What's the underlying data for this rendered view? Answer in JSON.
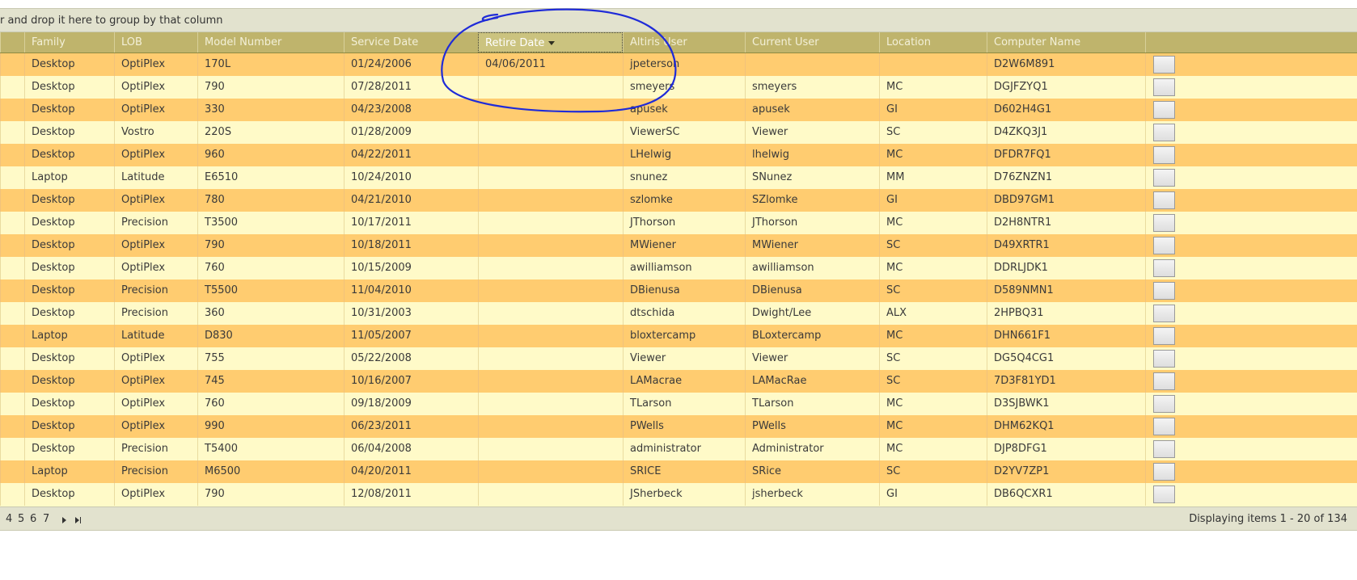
{
  "group_panel": {
    "hint": "r and drop it here to group by that column"
  },
  "columns": [
    {
      "label": "Family"
    },
    {
      "label": "LOB"
    },
    {
      "label": "Model Number"
    },
    {
      "label": "Service Date"
    },
    {
      "label": "Retire Date"
    },
    {
      "label": "Altiris User"
    },
    {
      "label": "Current User"
    },
    {
      "label": "Location"
    },
    {
      "label": "Computer Name"
    }
  ],
  "sorted_column": "Retire Date",
  "rows": [
    [
      "Desktop",
      "OptiPlex",
      "170L",
      "01/24/2006",
      "04/06/2011",
      "jpeterson",
      "",
      "",
      "D2W6M891"
    ],
    [
      "Desktop",
      "OptiPlex",
      "790",
      "07/28/2011",
      "",
      "smeyers",
      "smeyers",
      "MC",
      "DGJFZYQ1"
    ],
    [
      "Desktop",
      "OptiPlex",
      "330",
      "04/23/2008",
      "",
      "apusek",
      "apusek",
      "GI",
      "D602H4G1"
    ],
    [
      "Desktop",
      "Vostro",
      "220S",
      "01/28/2009",
      "",
      "ViewerSC",
      "Viewer",
      "SC",
      "D4ZKQ3J1"
    ],
    [
      "Desktop",
      "OptiPlex",
      "960",
      "04/22/2011",
      "",
      "LHelwig",
      "lhelwig",
      "MC",
      "DFDR7FQ1"
    ],
    [
      "Laptop",
      "Latitude",
      "E6510",
      "10/24/2010",
      "",
      "snunez",
      "SNunez",
      "MM",
      "D76ZNZN1"
    ],
    [
      "Desktop",
      "OptiPlex",
      "780",
      "04/21/2010",
      "",
      "szlomke",
      "SZlomke",
      "GI",
      "DBD97GM1"
    ],
    [
      "Desktop",
      "Precision",
      "T3500",
      "10/17/2011",
      "",
      "JThorson",
      "JThorson",
      "MC",
      "D2H8NTR1"
    ],
    [
      "Desktop",
      "OptiPlex",
      "790",
      "10/18/2011",
      "",
      "MWiener",
      "MWiener",
      "SC",
      "D49XRTR1"
    ],
    [
      "Desktop",
      "OptiPlex",
      "760",
      "10/15/2009",
      "",
      "awilliamson",
      "awilliamson",
      "MC",
      "DDRLJDK1"
    ],
    [
      "Desktop",
      "Precision",
      "T5500",
      "11/04/2010",
      "",
      "DBienusa",
      "DBienusa",
      "SC",
      "D589NMN1"
    ],
    [
      "Desktop",
      "Precision",
      "360",
      "10/31/2003",
      "",
      "dtschida",
      "Dwight/Lee",
      "ALX",
      "2HPBQ31"
    ],
    [
      "Laptop",
      "Latitude",
      "D830",
      "11/05/2007",
      "",
      "bloxtercamp",
      "BLoxtercamp",
      "MC",
      "DHN661F1"
    ],
    [
      "Desktop",
      "OptiPlex",
      "755",
      "05/22/2008",
      "",
      "Viewer",
      "Viewer",
      "SC",
      "DG5Q4CG1"
    ],
    [
      "Desktop",
      "OptiPlex",
      "745",
      "10/16/2007",
      "",
      "LAMacrae",
      "LAMacRae",
      "SC",
      "7D3F81YD1"
    ],
    [
      "Desktop",
      "OptiPlex",
      "760",
      "09/18/2009",
      "",
      "TLarson",
      "TLarson",
      "MC",
      "D3SJBWK1"
    ],
    [
      "Desktop",
      "OptiPlex",
      "990",
      "06/23/2011",
      "",
      "PWells",
      "PWells",
      "MC",
      "DHM62KQ1"
    ],
    [
      "Desktop",
      "Precision",
      "T5400",
      "06/04/2008",
      "",
      "administrator",
      "Administrator",
      "MC",
      "DJP8DFG1"
    ],
    [
      "Laptop",
      "Precision",
      "M6500",
      "04/20/2011",
      "",
      "SRICE",
      "SRice",
      "SC",
      "D2YV7ZP1"
    ],
    [
      "Desktop",
      "OptiPlex",
      "790",
      "12/08/2011",
      "",
      "JSherbeck",
      "jsherbeck",
      "GI",
      "DB6QCXR1"
    ]
  ],
  "pager": {
    "pages": [
      "4",
      "5",
      "6",
      "7"
    ],
    "status": "Displaying items 1 - 20 of 134"
  },
  "colors": {
    "row_alt": "#ffcc70",
    "row_base": "#fffac8",
    "header_bg": "#bfb46c",
    "annotation": "#1f2bd8"
  }
}
